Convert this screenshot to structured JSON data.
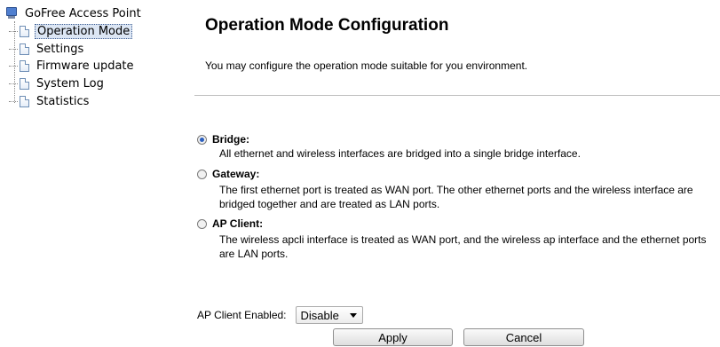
{
  "sidebar": {
    "root_label": "GoFree Access Point",
    "items": [
      {
        "label": "Operation Mode",
        "selected": true
      },
      {
        "label": "Settings",
        "selected": false
      },
      {
        "label": "Firmware update",
        "selected": false
      },
      {
        "label": "System Log",
        "selected": false
      },
      {
        "label": "Statistics",
        "selected": false
      }
    ]
  },
  "main": {
    "title": "Operation Mode Configuration",
    "intro": "You may configure the operation mode suitable for you environment.",
    "options": [
      {
        "label": "Bridge:",
        "checked": true,
        "description": "All ethernet and wireless interfaces are bridged into a single bridge interface."
      },
      {
        "label": "Gateway:",
        "checked": false,
        "description": "The first ethernet port is treated as WAN port. The other ethernet ports and the wireless interface are bridged together and are treated as LAN ports."
      },
      {
        "label": "AP Client:",
        "checked": false,
        "description": "The wireless apcli interface is treated as WAN port, and the wireless ap interface and the ethernet ports are LAN ports."
      }
    ],
    "ap_client": {
      "label": "AP Client Enabled:",
      "value": "Disable"
    },
    "buttons": {
      "apply": "Apply",
      "cancel": "Cancel"
    }
  },
  "colors": {
    "radio_selected": "#2b5fbe",
    "tree_selected_bg": "#dce6f4"
  }
}
